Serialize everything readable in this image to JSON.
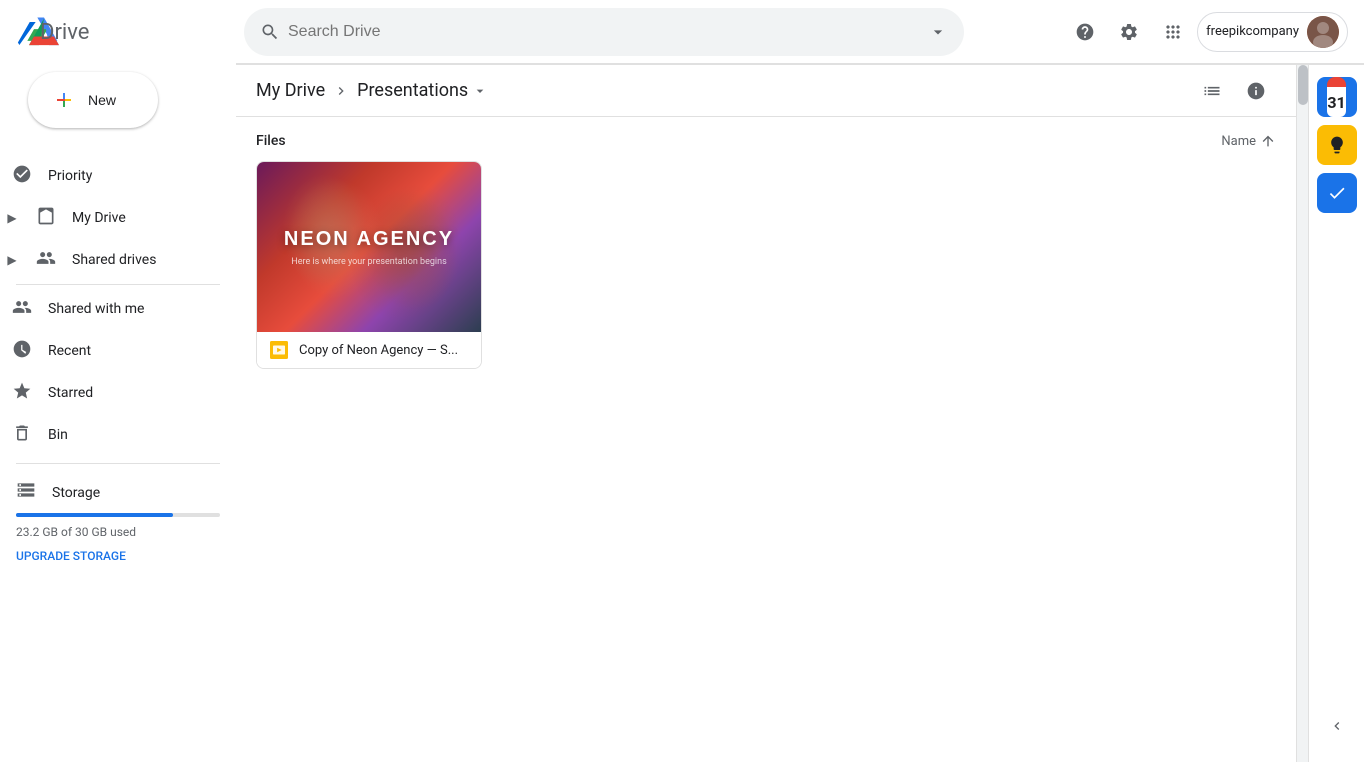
{
  "app": {
    "title": "Drive",
    "logo_text": "Drive"
  },
  "header": {
    "search_placeholder": "Search Drive",
    "help_label": "Help",
    "settings_label": "Settings",
    "apps_label": "Google Apps",
    "account_name": "freepikcompany"
  },
  "sidebar": {
    "new_button": "New",
    "nav_items": [
      {
        "id": "priority",
        "label": "Priority",
        "icon": "check-circle"
      },
      {
        "id": "my-drive",
        "label": "My Drive",
        "icon": "my-drive",
        "expandable": true
      },
      {
        "id": "shared-drives",
        "label": "Shared drives",
        "icon": "shared-drives",
        "expandable": true
      },
      {
        "id": "shared-with-me",
        "label": "Shared with me",
        "icon": "people"
      },
      {
        "id": "recent",
        "label": "Recent",
        "icon": "clock"
      },
      {
        "id": "starred",
        "label": "Starred",
        "icon": "star"
      },
      {
        "id": "bin",
        "label": "Bin",
        "icon": "trash"
      }
    ],
    "storage": {
      "label": "Storage",
      "used_text": "23.2 GB of 30 GB used",
      "upgrade_label": "UPGRADE STORAGE",
      "percent": 77
    }
  },
  "breadcrumb": {
    "root": "My Drive",
    "current": "Presentations"
  },
  "content": {
    "sort_label": "Name",
    "section_title": "Files",
    "files": [
      {
        "id": "neon-agency",
        "name": "Copy of Neon Agency — S...",
        "type": "slides",
        "title_line1": "NEON AGENCY",
        "title_line2": "Here is where your presentation begins"
      }
    ]
  },
  "right_panel": {
    "calendar_date": "31",
    "keep_label": "Keep",
    "tasks_label": "Tasks"
  }
}
